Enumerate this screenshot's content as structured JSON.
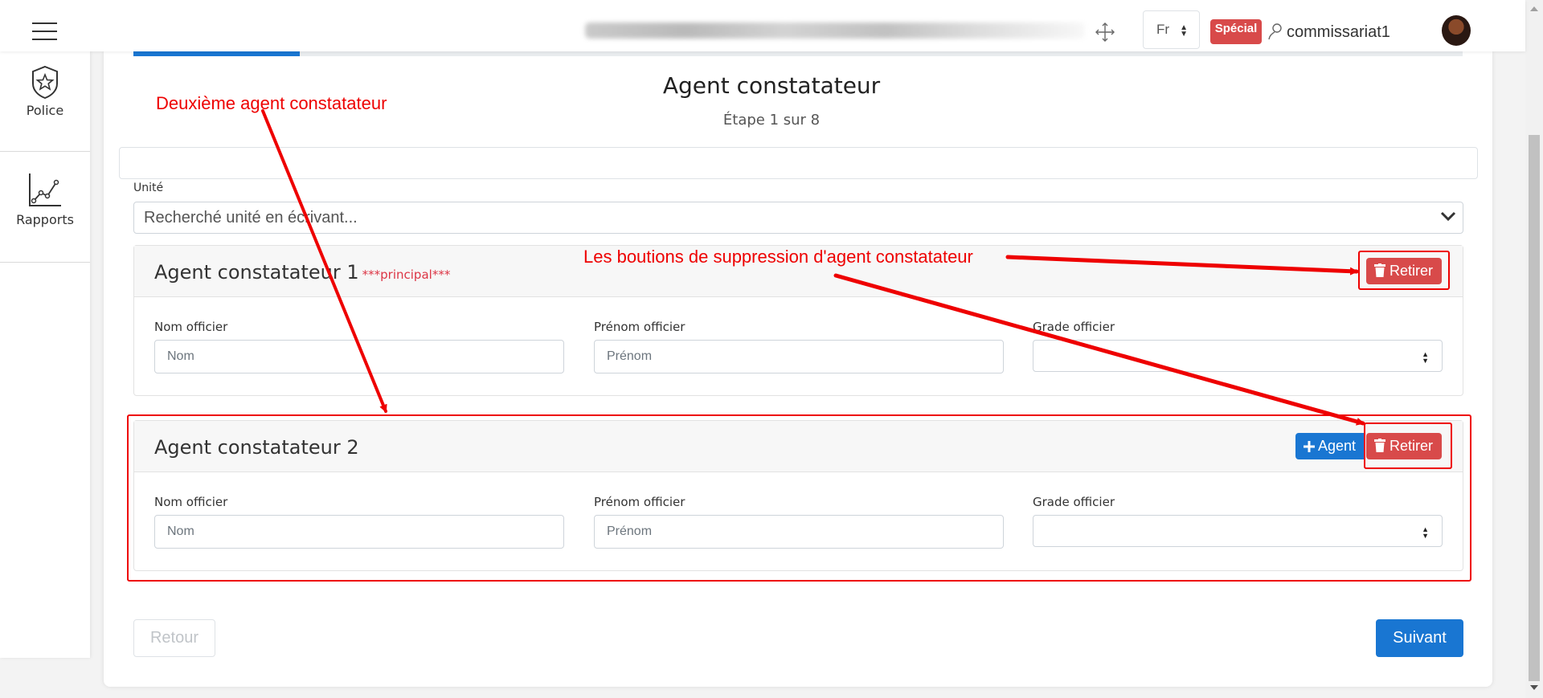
{
  "topbar": {
    "language": "Fr",
    "badge": "Spécial",
    "username": "commissariat1"
  },
  "sidebar": {
    "items": [
      {
        "label": "Police",
        "icon": "police-badge-icon"
      },
      {
        "label": "Rapports",
        "icon": "line-chart-icon"
      }
    ]
  },
  "wizard": {
    "title": "Agent constatateur",
    "step": "Étape 1 sur 8",
    "progress": 0.125
  },
  "unit": {
    "label": "Unité",
    "placeholder": "Recherché unité en écrivant..."
  },
  "agents": [
    {
      "title": "Agent constatateur 1",
      "tag": "***principal***",
      "remove_label": "Retirer",
      "nom_label": "Nom officier",
      "nom_placeholder": "Nom",
      "prenom_label": "Prénom officier",
      "prenom_placeholder": "Prénom",
      "grade_label": "Grade officier"
    },
    {
      "title": "Agent constatateur 2",
      "add_label": "Agent",
      "remove_label": "Retirer",
      "nom_label": "Nom officier",
      "nom_placeholder": "Nom",
      "prenom_label": "Prénom officier",
      "prenom_placeholder": "Prénom",
      "grade_label": "Grade officier"
    }
  ],
  "footer": {
    "back_label": "Retour",
    "next_label": "Suivant"
  },
  "annotations": {
    "second_agent": "Deuxième agent constatateur",
    "delete_buttons": "Les boutions de suppression d'agent constatateur"
  },
  "colors": {
    "primary": "#1976d2",
    "danger": "#d84a4a",
    "annotation": "#ee0000"
  }
}
